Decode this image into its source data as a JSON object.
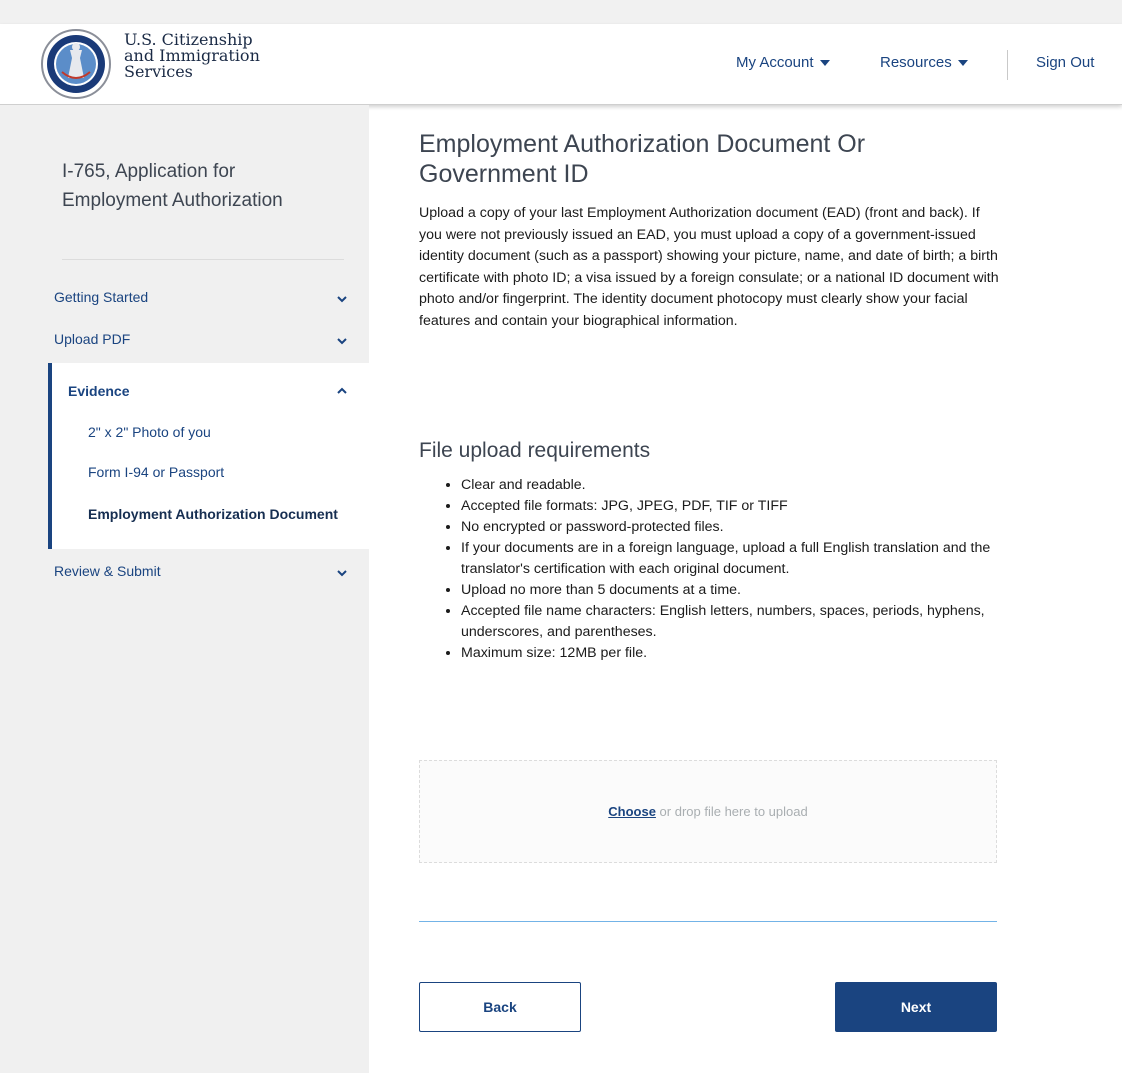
{
  "header": {
    "logo_lines": [
      "U.S. Citizenship",
      "and Immigration",
      "Services"
    ],
    "logo_icon": "uscis-seal-icon",
    "nav": {
      "my_account": "My Account",
      "resources": "Resources",
      "sign_out": "Sign Out"
    }
  },
  "sidebar": {
    "form_title": "I-765, Application for Employment Authorization",
    "sections": {
      "getting_started": "Getting Started",
      "upload_pdf": "Upload PDF",
      "evidence": "Evidence",
      "review_submit": "Review & Submit"
    },
    "evidence_items": [
      "2\" x 2\" Photo of you",
      "Form I-94 or Passport",
      "Employment Authorization Document"
    ]
  },
  "main": {
    "title": "Employment Authorization Document Or Government ID",
    "intro": "Upload a copy of your last Employment Authorization document (EAD) (front and back). If you were not previously issued an EAD, you must upload a copy of a government-issued identity document (such as a passport) showing your picture, name, and date of birth; a birth certificate with photo ID; a visa issued by a foreign consulate; or a national ID document with photo and/or fingerprint. The identity document photocopy must clearly show your facial features and contain your biographical information.",
    "requirements_title": "File upload requirements",
    "requirements": [
      "Clear and readable.",
      "Accepted file formats: JPG, JPEG, PDF, TIF or TIFF",
      "No encrypted or password-protected files.",
      "If your documents are in a foreign language, upload a full English translation and the translator's certification with each original document.",
      "Upload no more than 5 documents at a time.",
      "Accepted file name characters: English letters, numbers, spaces, periods, hyphens, underscores, and parentheses.",
      "Maximum size: 12MB per file."
    ],
    "upload": {
      "choose": "Choose",
      "rest": " or drop file here to upload"
    },
    "buttons": {
      "back": "Back",
      "next": "Next"
    }
  },
  "colors": {
    "primary": "#1a4480",
    "sidebar_bg": "#f0f0f0",
    "divider_blue": "#73b3e7"
  }
}
